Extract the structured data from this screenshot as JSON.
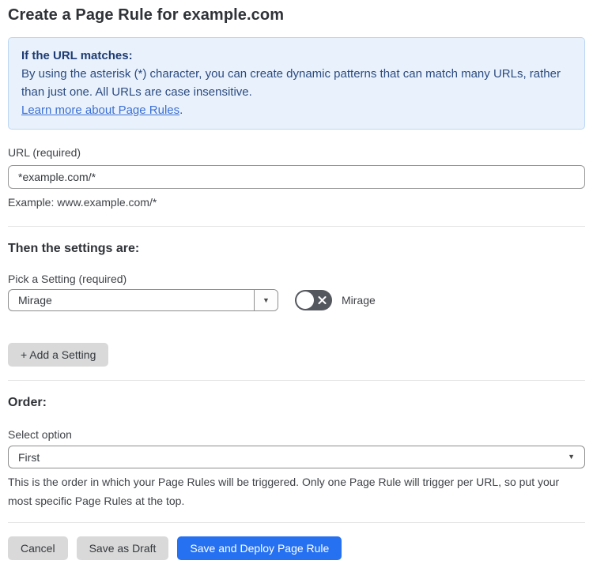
{
  "header": {
    "title": "Create a Page Rule for example.com"
  },
  "info_box": {
    "heading": "If the URL matches:",
    "body": "By using the asterisk (*) character, you can create dynamic patterns that can match many URLs, rather than just one. All URLs are case insensitive.",
    "link_label": "Learn more about Page Rules",
    "link_suffix": "."
  },
  "url_field": {
    "label": "URL (required)",
    "value": "*example.com/*",
    "helper": "Example: www.example.com/*"
  },
  "settings_section": {
    "heading": "Then the settings are:",
    "picker_label": "Pick a Setting (required)",
    "selected_setting": "Mirage",
    "toggle": {
      "state": "off",
      "label": "Mirage"
    },
    "add_setting_label": "+ Add a Setting"
  },
  "order_section": {
    "heading": "Order:",
    "select_label": "Select option",
    "selected_option": "First",
    "helper": "This is the order in which your Page Rules will be triggered. Only one Page Rule will trigger per URL, so put your most specific Page Rules at the top."
  },
  "footer": {
    "cancel_label": "Cancel",
    "save_draft_label": "Save as Draft",
    "save_deploy_label": "Save and Deploy Page Rule"
  },
  "icons": {
    "dropdown_arrow": "▼",
    "toggle_off_icon": "x-icon"
  },
  "colors": {
    "info_box_bg": "#e9f2fc",
    "info_box_border": "#bcd6f2",
    "info_heading_text": "#1e3b73",
    "info_body_text": "#2b4a80",
    "link": "#3b6fd4",
    "primary_button_bg": "#2671f1",
    "gray_button_bg": "#d9d9d9",
    "toggle_off_bg": "#54575e"
  }
}
